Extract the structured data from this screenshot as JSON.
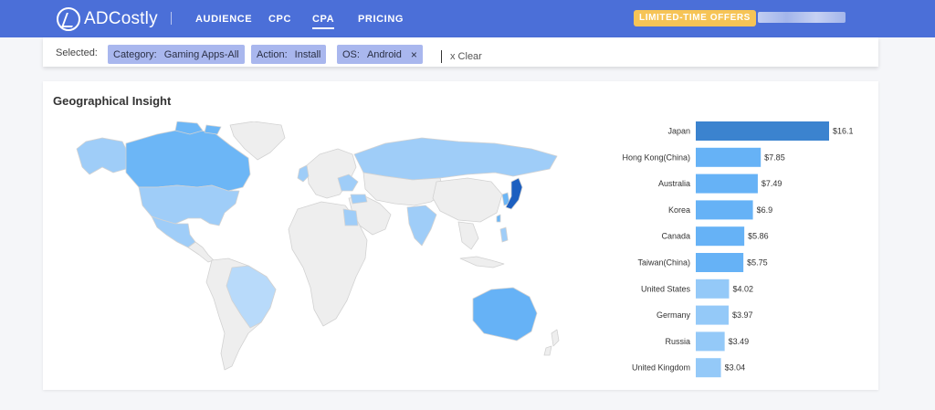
{
  "header": {
    "logo_text": "ADCostly",
    "nav": [
      {
        "label": "AUDIENCE",
        "active": false
      },
      {
        "label": "CPC",
        "active": false
      },
      {
        "label": "CPA",
        "active": true
      },
      {
        "label": "PRICING",
        "active": false
      }
    ],
    "offer_label": "LIMITED-TIME OFFERS"
  },
  "filters": {
    "label": "Selected:",
    "chips": [
      {
        "key": "Category:",
        "value": "Gaming Apps-All",
        "removable": false
      },
      {
        "key": "Action:",
        "value": "Install",
        "removable": false
      },
      {
        "key": "OS:",
        "value": "Android",
        "removable": true
      }
    ],
    "remove_glyph": "×",
    "clear_label": "x Clear"
  },
  "panel": {
    "title": "Geographical Insight"
  },
  "colors": {
    "header_bg": "#4b6fd8",
    "chip_bg": "#a9b7ee",
    "offer_bg": "#f6c456",
    "bar_top": "#3b83cf",
    "bar_mid": "#66b2f6",
    "bar_low": "#94c9f8",
    "map_land": "#eeeeee",
    "map_border": "#d2d2d2"
  },
  "chart_data": {
    "type": "bar",
    "orientation": "horizontal",
    "categories": [
      "Japan",
      "Hong Kong(China)",
      "Australia",
      "Korea",
      "Canada",
      "Taiwan(China)",
      "United States",
      "Germany",
      "Russia",
      "United Kingdom"
    ],
    "values": [
      16.1,
      7.85,
      7.49,
      6.9,
      5.86,
      5.75,
      4.02,
      3.97,
      3.49,
      3.04
    ],
    "value_labels": [
      "$16.1",
      "$7.85",
      "$7.49",
      "$6.9",
      "$5.86",
      "$5.75",
      "$4.02",
      "$3.97",
      "$3.49",
      "$3.04"
    ],
    "xlim": [
      0,
      16.1
    ],
    "grid": false,
    "legend": false
  }
}
